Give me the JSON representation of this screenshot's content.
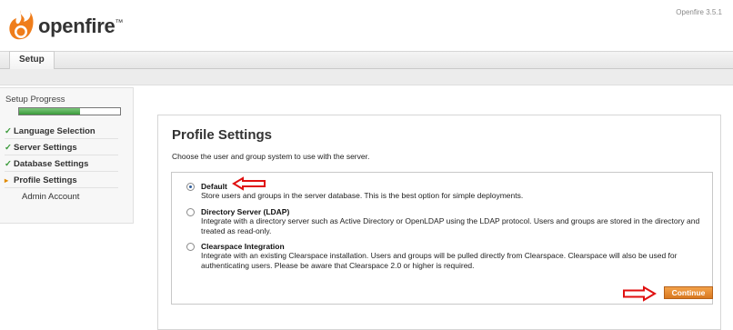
{
  "header": {
    "brand_name": "openfire",
    "trademark": "™",
    "version": "Openfire 3.5.1",
    "logo_icon": "flame-icon"
  },
  "tabs": [
    {
      "label": "Setup"
    }
  ],
  "sidebar": {
    "title": "Setup Progress",
    "progress_fraction": 0.6,
    "steps": [
      {
        "label": "Language Selection",
        "status": "done",
        "mark": "✓"
      },
      {
        "label": "Server Settings",
        "status": "done",
        "mark": "✓"
      },
      {
        "label": "Database Settings",
        "status": "done",
        "mark": "✓"
      },
      {
        "label": "Profile Settings",
        "status": "current",
        "mark": "▸"
      },
      {
        "label": "Admin Account",
        "status": "todo",
        "mark": ""
      }
    ]
  },
  "main": {
    "title": "Profile Settings",
    "description": "Choose the user and group system to use with the server.",
    "options": [
      {
        "label": "Default",
        "description": "Store users and groups in the server database. This is the best option for simple deployments.",
        "selected": true
      },
      {
        "label": "Directory Server (LDAP)",
        "description": "Integrate with a directory server such as Active Directory or OpenLDAP using the LDAP protocol. Users and groups are stored in the directory and treated as read-only.",
        "selected": false
      },
      {
        "label": "Clearspace Integration",
        "description": "Integrate with an existing Clearspace installation. Users and groups will be pulled directly from Clearspace. Clearspace will also be used for authenticating users. Please be aware that Clearspace 2.0 or higher is required.",
        "selected": false
      }
    ],
    "continue_label": "Continue"
  },
  "colors": {
    "accent_orange": "#e08a00",
    "progress_green": "#3a9a3a",
    "annotation_red": "#e01010",
    "radio_blue": "#2f5c9a"
  }
}
